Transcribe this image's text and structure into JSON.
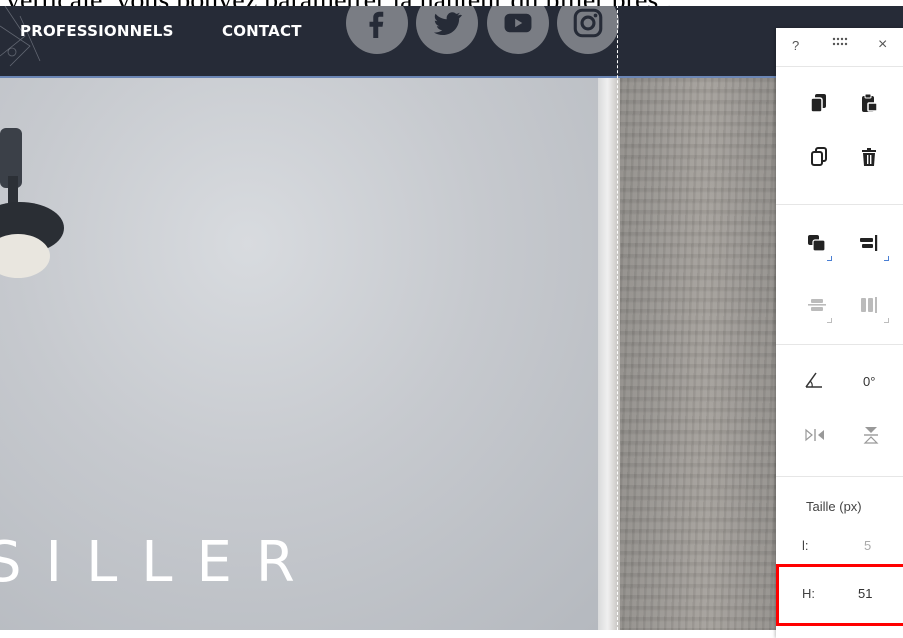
{
  "caption": {
    "text": "verticale, vous pouvez paramétrer la hauteur du pilier près :"
  },
  "header": {
    "nav": [
      "PROFESSIONNELS",
      "CONTACT"
    ],
    "social_icons": [
      "facebook-icon",
      "twitter-icon",
      "youtube-icon",
      "instagram-icon"
    ]
  },
  "hero": {
    "title": "SILLER"
  },
  "panel": {
    "help_label": "?",
    "close_label": "×",
    "rotation": {
      "value": "0°"
    },
    "size": {
      "title": "Taille (px)",
      "width_label": "l:",
      "width_value": "5",
      "height_label": "H:",
      "height_value": "51"
    }
  },
  "colors": {
    "header_bg": "#262b37",
    "highlight": "#ff0000",
    "accent_blue": "#4a7fd4"
  }
}
